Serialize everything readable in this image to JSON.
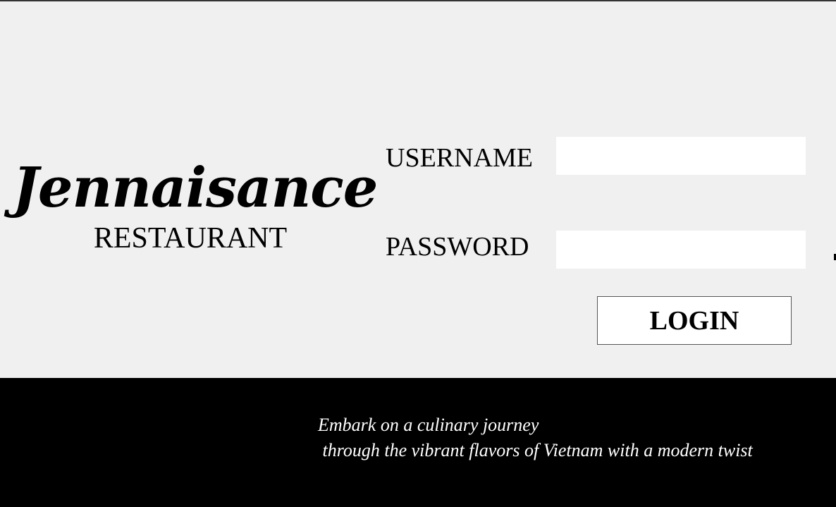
{
  "brand": {
    "name": "Jennaisance",
    "subtitle": "RESTAURANT"
  },
  "login_form": {
    "username_label": "USERNAME",
    "username_value": "",
    "password_label": "PASSWORD",
    "password_value": "",
    "login_button_label": "LOGIN"
  },
  "footer": {
    "tagline_line1": "Embark on a culinary journey",
    "tagline_line2": " through the vibrant flavors of Vietnam with a modern twist"
  },
  "colors": {
    "background": "#f0f0f0",
    "footer_background": "#000000",
    "text": "#000000",
    "footer_text": "#ffffff",
    "field_background": "#ffffff"
  }
}
